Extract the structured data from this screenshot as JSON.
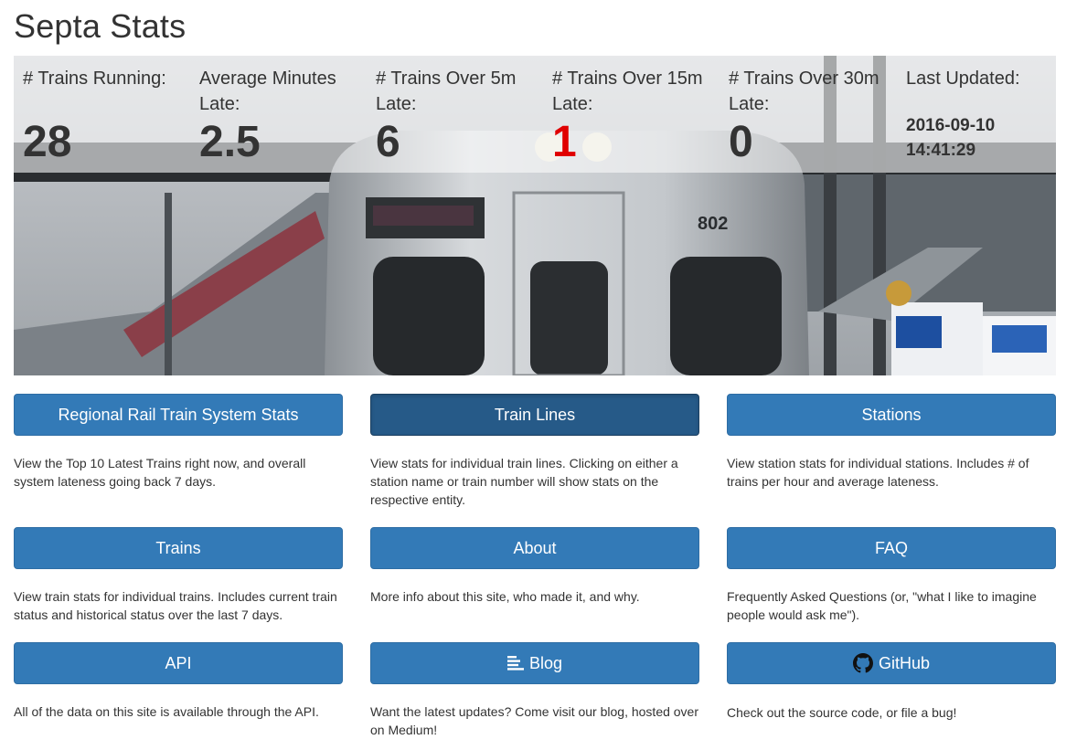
{
  "page": {
    "title": "Septa Stats"
  },
  "stats": [
    {
      "label": "# Trains Running:",
      "value": "28"
    },
    {
      "label": "Average Minutes Late:",
      "value": "2.5"
    },
    {
      "label": "# Trains Over 5m Late:",
      "value": "6"
    },
    {
      "label": "# Trains Over 15m Late:",
      "value": "1",
      "color": "#e00000"
    },
    {
      "label": "# Trains Over 30m Late:",
      "value": "0"
    },
    {
      "label": "Last Updated:",
      "date": "2016-09-10",
      "time": "14:41:29"
    }
  ],
  "hero": {
    "train_number": "802"
  },
  "nav": [
    {
      "label": "Regional Rail Train System Stats",
      "description": "View the Top 10 Latest Trains right now, and overall system lateness going back 7 days."
    },
    {
      "label": "Train Lines",
      "description": "View stats for individual train lines. Clicking on either a station name or train number will show stats on the respective entity."
    },
    {
      "label": "Stations",
      "description": "View station stats for individual stations. Includes # of trains per hour and average lateness."
    },
    {
      "label": "Trains",
      "description": "View train stats for individual trains. Includes current train status and historical status over the last 7 days."
    },
    {
      "label": "About",
      "description": "More info about this site, who made it, and why."
    },
    {
      "label": "FAQ",
      "description": "Frequently Asked Questions (or, \"what I like to imagine people would ask me\")."
    },
    {
      "label": "API",
      "description": "All of the data on this site is available through the API."
    },
    {
      "label": "Blog",
      "icon": "blog-list-icon",
      "description": "Want the latest updates? Come visit our blog, hosted over on Medium!"
    },
    {
      "label": "GitHub",
      "icon": "github-icon",
      "description": "Check out the source code, or file a bug!"
    }
  ],
  "colors": {
    "button": "#337ab7",
    "button_active": "#265a88",
    "alert": "#e00000"
  }
}
